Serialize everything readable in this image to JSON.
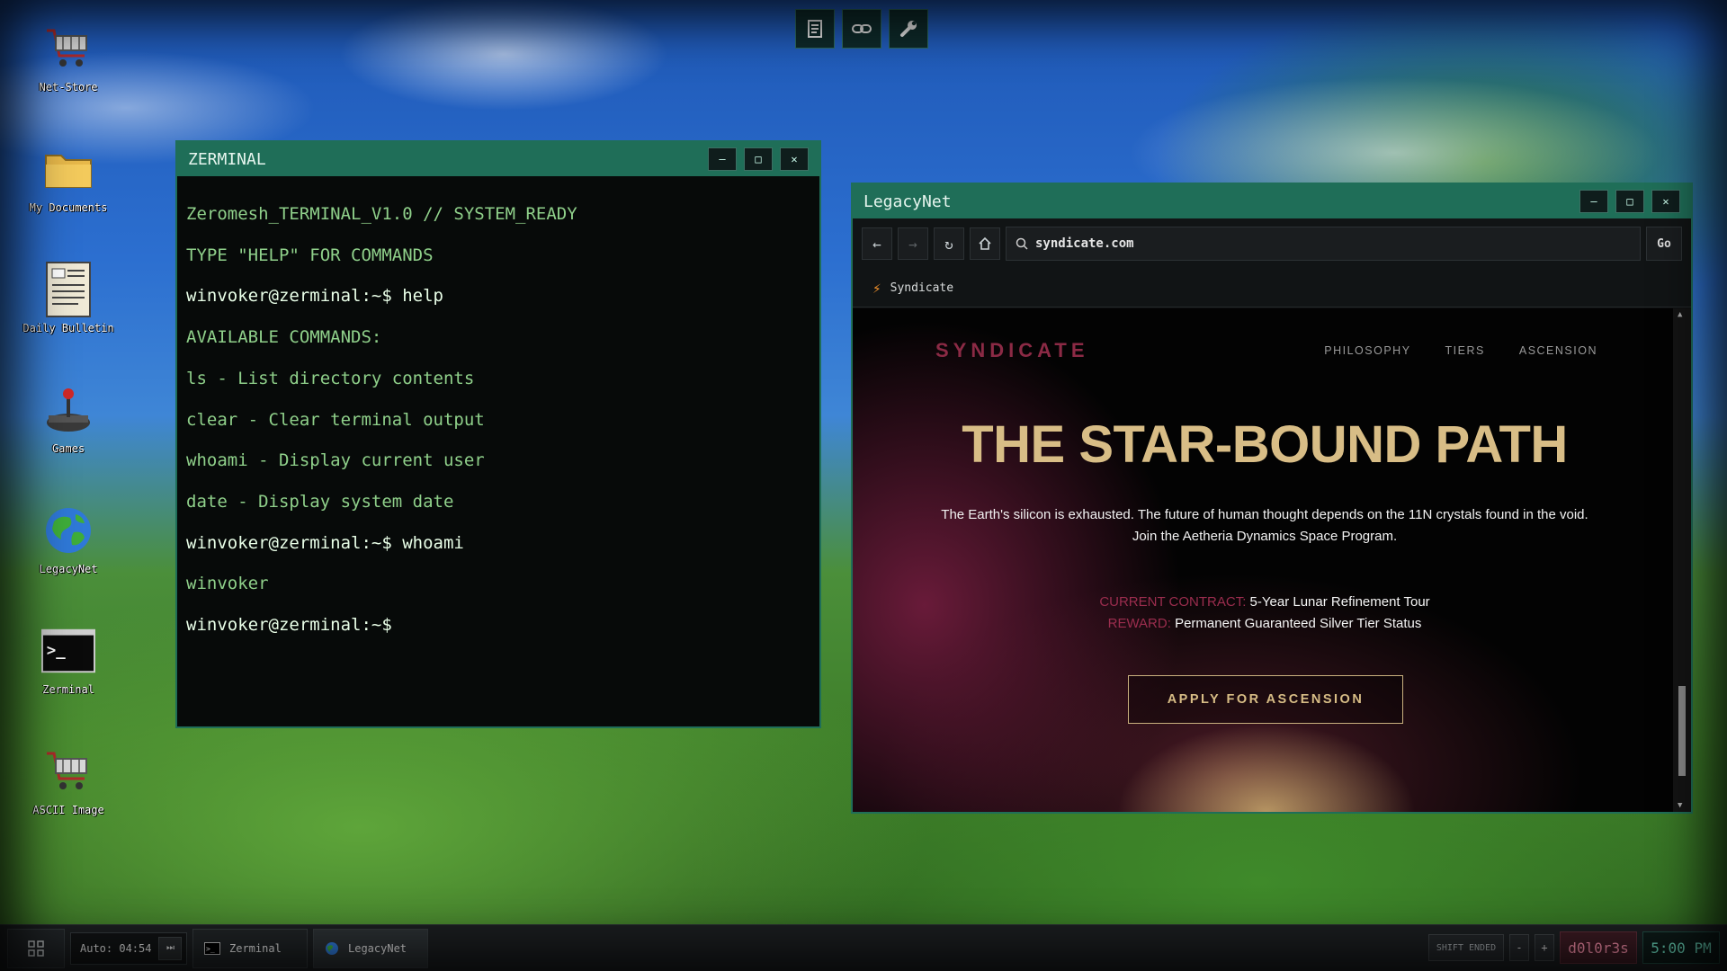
{
  "toolbar": {
    "icons": [
      "notes-icon",
      "link-icon",
      "wrench-icon"
    ]
  },
  "desktop_icons": [
    {
      "label": "Net-Store",
      "icon": "shopping-cart-icon"
    },
    {
      "label": "My Documents",
      "icon": "folder-icon"
    },
    {
      "label": "Daily Bulletin",
      "icon": "document-icon"
    },
    {
      "label": "Games",
      "icon": "joystick-icon"
    },
    {
      "label": "LegacyNet",
      "icon": "globe-icon"
    },
    {
      "label": "Zerminal",
      "icon": "terminal-icon"
    },
    {
      "label": "ASCII Image",
      "icon": "shopping-cart-icon"
    }
  ],
  "terminal": {
    "title": "ZERMINAL",
    "lines": [
      "Zeromesh_TERMINAL_V1.0 // SYSTEM_READY",
      "TYPE \"HELP\" FOR COMMANDS",
      "winvoker@zerminal:~$ help",
      "AVAILABLE COMMANDS:",
      "ls - List directory contents",
      "clear - Clear terminal output",
      "whoami - Display current user",
      "date - Display system date",
      "winvoker@zerminal:~$ whoami",
      "winvoker",
      "winvoker@zerminal:~$"
    ]
  },
  "browser": {
    "title": "LegacyNet",
    "url": "syndicate.com",
    "go_label": "Go",
    "bookmark": "Syndicate",
    "page": {
      "brand": "SYNDICATE",
      "nav": [
        "PHILOSOPHY",
        "TIERS",
        "ASCENSION"
      ],
      "hero_title": "THE STAR-BOUND PATH",
      "hero_text": "The Earth's silicon is exhausted. The future of human thought depends on the 11N crystals found in the void. Join the Aetheria Dynamics Space Program.",
      "contract_label": "CURRENT CONTRACT:",
      "contract_value": "5-Year Lunar Refinement Tour",
      "reward_label": "REWARD:",
      "reward_value": "Permanent Guaranteed Silver Tier Status",
      "cta": "APPLY FOR ASCENSION"
    }
  },
  "taskbar": {
    "auto_label": "Auto: 04:54",
    "tasks": [
      "Zerminal",
      "LegacyNet"
    ],
    "shift_status": "SHIFT ENDED",
    "minus": "-",
    "plus": "+",
    "user": "d0l0r3s",
    "clock": "5:00 PM"
  },
  "colors": {
    "accent": "#1f6e58",
    "terminal_text": "#8fd08a",
    "brand": "#8b2a45",
    "gold": "#d8bd86"
  }
}
